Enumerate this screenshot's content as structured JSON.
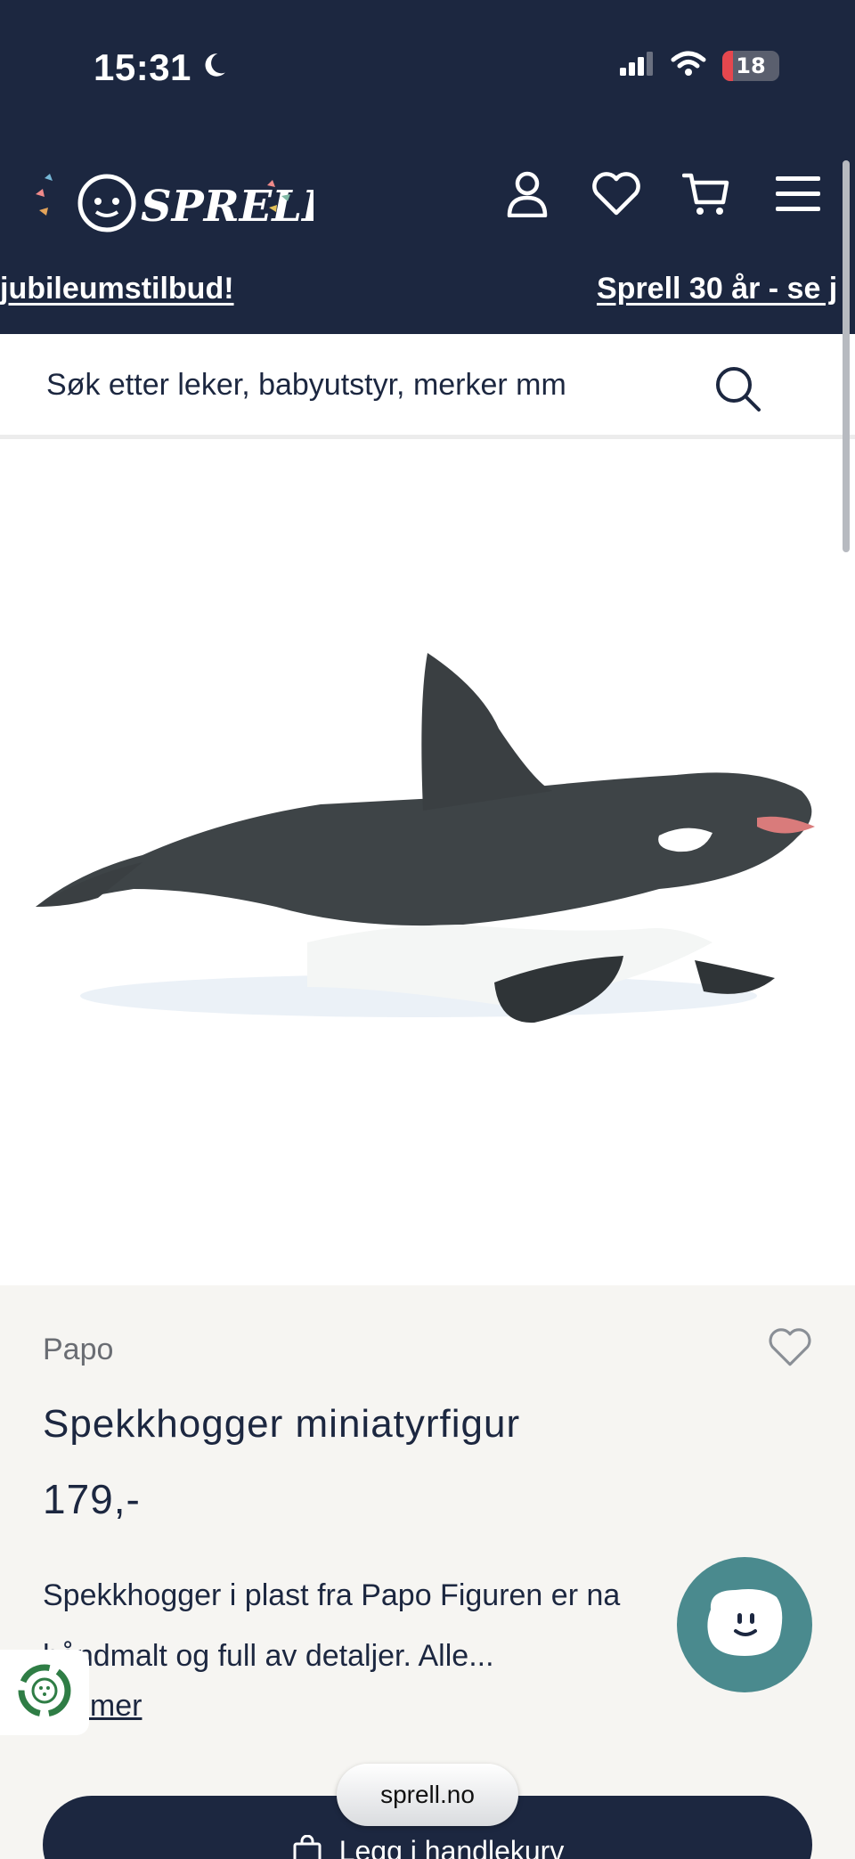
{
  "status_bar": {
    "time": "15:31",
    "battery": "18",
    "battery_level": 0.18
  },
  "header": {
    "logo_text": "SPRELL"
  },
  "marquee": {
    "left_text": "jubileumstilbud!",
    "right_text": "Sprell 30 år - se j"
  },
  "search": {
    "placeholder": "Søk etter leker, babyutstyr, merker mm"
  },
  "product": {
    "brand": "Papo",
    "title": "Spekkhogger miniatyrfigur",
    "price": "179,-",
    "description_lines": [
      "Spekkhogger i plast fra Papo Figuren er na",
      "håndmalt og full av detaljer. Alle..."
    ],
    "read_more": "; mer"
  },
  "cart_button": {
    "label": "Legg i handlekurv"
  },
  "browser": {
    "url": "sprell.no"
  },
  "colors": {
    "navy": "#1c2740",
    "teal": "#4a8a8e",
    "battery_red": "#e5474e"
  },
  "icons": {
    "status": [
      "moon-icon",
      "signal-icon",
      "wifi-icon",
      "battery-icon"
    ],
    "header": [
      "account-icon",
      "heart-icon",
      "cart-icon",
      "menu-icon"
    ],
    "other": [
      "search-icon",
      "favorite-heart-icon",
      "recycle-icon",
      "chat-face-icon",
      "shopping-bag-icon"
    ]
  }
}
